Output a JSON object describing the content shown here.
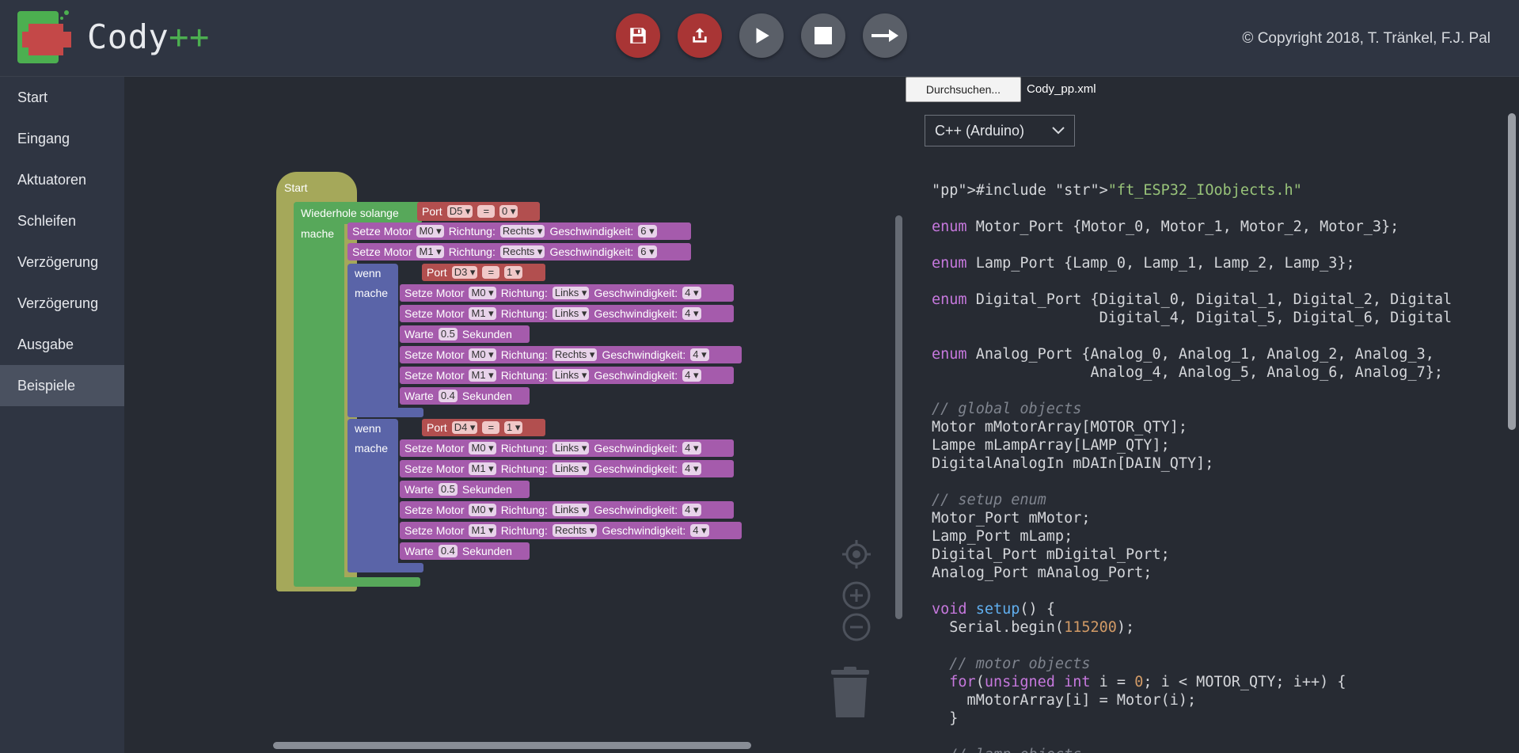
{
  "app": {
    "name_main": "Cody",
    "name_suffix": "++"
  },
  "copyright": "© Copyright 2018, T. Tränkel, F.J. Pal",
  "toolbar": {
    "buttons": [
      {
        "icon": "save-icon",
        "color": "#a93535"
      },
      {
        "icon": "upload-icon",
        "color": "#a93535"
      },
      {
        "icon": "play-icon",
        "color": "#5a5f68"
      },
      {
        "icon": "stop-icon",
        "color": "#5a5f68"
      },
      {
        "icon": "arrow-right-icon",
        "color": "#5a5f68"
      }
    ]
  },
  "sidebar": {
    "items": [
      {
        "label": "Start"
      },
      {
        "label": "Eingang"
      },
      {
        "label": "Aktuatoren"
      },
      {
        "label": "Schleifen"
      },
      {
        "label": "Verzögerung"
      },
      {
        "label": "Verzögerung"
      },
      {
        "label": "Ausgabe"
      },
      {
        "label": "Beispiele"
      }
    ],
    "active": "Beispiele"
  },
  "blocks": {
    "start": "Start",
    "while": "Wiederhole solange",
    "do": "mache",
    "if": "wenn",
    "port": "Port",
    "eq": "=",
    "set_motor": "Setze Motor",
    "direction": "Richtung:",
    "speed": "Geschwindigkeit:",
    "wait": "Warte",
    "seconds": "Sekunden",
    "while_port": "D5",
    "while_value": "0",
    "m0": "M0",
    "m1": "M1",
    "rechts": "Rechts",
    "links": "Links",
    "six": "6",
    "four": "4",
    "if1_port": "D3",
    "if2_port": "D4",
    "one": "1",
    "w05": "0.5",
    "w04": "0.4"
  },
  "file": {
    "button_label": "Durchsuchen...",
    "file_name": "Cody_pp.xml"
  },
  "language_select": {
    "selected": "C++ (Arduino)"
  },
  "code_lines": [
    "#include \"ft_ESP32_IOobjects.h\"",
    "",
    "enum Motor_Port {Motor_0, Motor_1, Motor_2, Motor_3};",
    "",
    "enum Lamp_Port {Lamp_0, Lamp_1, Lamp_2, Lamp_3};",
    "",
    "enum Digital_Port {Digital_0, Digital_1, Digital_2, Digital",
    "                   Digital_4, Digital_5, Digital_6, Digital",
    "",
    "enum Analog_Port {Analog_0, Analog_1, Analog_2, Analog_3,",
    "                  Analog_4, Analog_5, Analog_6, Analog_7};",
    "",
    "// global objects",
    "Motor mMotorArray[MOTOR_QTY];",
    "Lampe mLampArray[LAMP_QTY];",
    "DigitalAnalogIn mDAIn[DAIN_QTY];",
    "",
    "// setup enum",
    "Motor_Port mMotor;",
    "Lamp_Port mLamp;",
    "Digital_Port mDigital_Port;",
    "Analog_Port mAnalog_Port;",
    "",
    "void setup() {",
    "  Serial.begin(115200);",
    "",
    "  // motor objects",
    "  for(unsigned int i = 0; i < MOTOR_QTY; i++) {",
    "    mMotorArray[i] = Motor(i);",
    "  }",
    "",
    "  // lamp objects"
  ]
}
